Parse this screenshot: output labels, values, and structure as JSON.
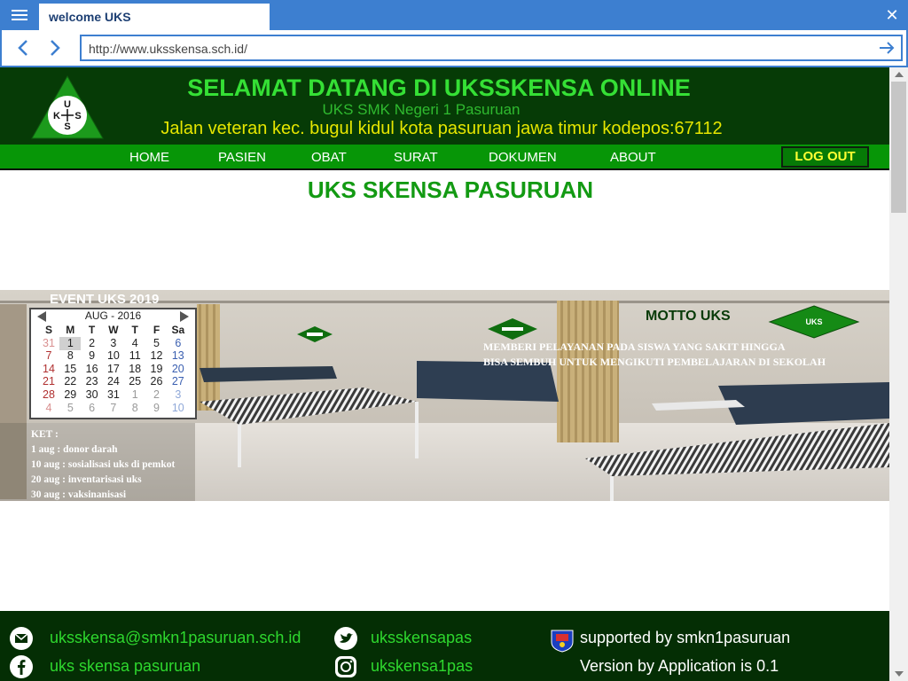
{
  "browser": {
    "tab_title": "welcome UKS",
    "url": "http://www.uksskensa.sch.id/"
  },
  "header": {
    "logo_text": [
      "U",
      "K",
      "S",
      "S"
    ],
    "title": "SELAMAT DATANG DI UKSSKENSA ONLINE",
    "subtitle": "UKS SMK Negeri 1 Pasuruan",
    "address": "Jalan veteran kec. bugul kidul kota pasuruan jawa timur kodepos:67112"
  },
  "nav": {
    "items": [
      "HOME",
      "PASIEN",
      "OBAT",
      "SURAT",
      "DOKUMEN",
      "ABOUT"
    ],
    "logout": "LOG OUT"
  },
  "main": {
    "heading": "UKS SKENSA PASURUAN"
  },
  "event": {
    "title": "EVENT UKS 2019",
    "calendar": {
      "month_label": "AUG - 2016",
      "weekdays": [
        "S",
        "M",
        "T",
        "W",
        "T",
        "F",
        "Sa"
      ],
      "weeks": [
        [
          "31",
          "1",
          "2",
          "3",
          "4",
          "5",
          "6"
        ],
        [
          "7",
          "8",
          "9",
          "10",
          "11",
          "12",
          "13"
        ],
        [
          "14",
          "15",
          "16",
          "17",
          "18",
          "19",
          "20"
        ],
        [
          "21",
          "22",
          "23",
          "24",
          "25",
          "26",
          "27"
        ],
        [
          "28",
          "29",
          "30",
          "31",
          "1",
          "2",
          "3"
        ],
        [
          "4",
          "5",
          "6",
          "7",
          "8",
          "9",
          "10"
        ]
      ],
      "highlighted_day": "1"
    },
    "ket_label": "KET :",
    "notes": [
      "1 aug : donor darah",
      "10 aug : sosialisasi uks di pemkot",
      "20 aug : inventarisasi uks",
      "30 aug : vaksinanisasi"
    ]
  },
  "motto": {
    "title": "MOTTO UKS",
    "lines": [
      "MEMBERI PELAYANAN PADA SISWA YANG SAKIT HINGGA",
      "BISA SEMBUH UNTUK MENGIKUTI PEMBELAJARAN DI SEKOLAH"
    ],
    "sign_text": "UKS"
  },
  "footer": {
    "email": "uksskensa@smkn1pasuruan.sch.id",
    "twitter": "uksskensapas",
    "supported": "supported by smkn1pasuruan",
    "facebook": "uks skensa pasuruan",
    "instagram": "ukskensa1pas",
    "version": "Version by Application is 0.1"
  },
  "colors": {
    "chrome_blue": "#3d7fd0",
    "header_bg": "#063b06",
    "title_green": "#35e035",
    "address_yellow": "#e6e600",
    "nav_green": "#079607",
    "heading_green": "#139a13",
    "footer_bg": "#042e04",
    "footer_link": "#2ed82e"
  },
  "icons": [
    "menu-icon",
    "close-icon",
    "back-arrow-icon",
    "forward-arrow-icon",
    "go-arrow-icon",
    "email-icon",
    "twitter-icon",
    "facebook-icon",
    "instagram-icon",
    "school-emblem-icon"
  ]
}
